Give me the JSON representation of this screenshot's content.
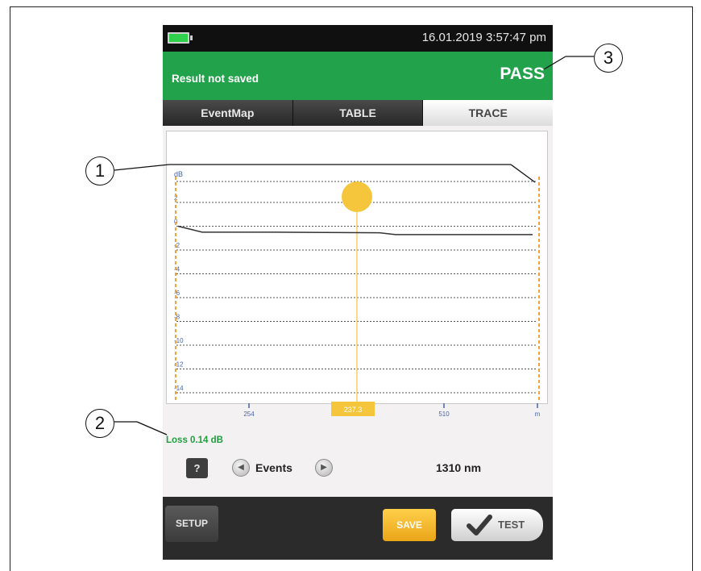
{
  "status_bar": {
    "datetime": "16.01.2019 3:57:47 pm",
    "battery_icon": "battery-icon",
    "battery_color": "#2fd14c"
  },
  "result": {
    "saved_text": "Result not saved",
    "status": "PASS",
    "color": "#22a24b"
  },
  "tabs": [
    {
      "label": "EventMap",
      "active": false
    },
    {
      "label": "TABLE",
      "active": false
    },
    {
      "label": "TRACE",
      "active": true
    }
  ],
  "chart_data": {
    "type": "line",
    "ylabel": "dB",
    "y_ticks": [
      "2",
      "0",
      "-2",
      "-4",
      "-6",
      "-8",
      "-10",
      "-12",
      "-14"
    ],
    "x_ticks": [
      "254",
      "237.3",
      "510",
      "m"
    ],
    "series": [
      {
        "x": [
          0,
          30,
          120,
          250,
          270,
          330,
          440
        ],
        "y": [
          0,
          -0.5,
          -0.5,
          -0.55,
          -0.7,
          -0.7,
          -0.7
        ]
      }
    ],
    "cursor_value": "237.3",
    "grid": true,
    "cursor_color": "#f5c63c",
    "marker_color": "#f0a33a"
  },
  "loss": {
    "label": "Loss 0.14 dB"
  },
  "controls": {
    "help_label": "?",
    "events_label": "Events",
    "wavelength": "1310 nm"
  },
  "bottom": {
    "setup_label": "SETUP",
    "save_label": "SAVE",
    "test_label": "TEST",
    "save_color": "#f5b62a"
  },
  "callouts": [
    "1",
    "2",
    "3"
  ]
}
